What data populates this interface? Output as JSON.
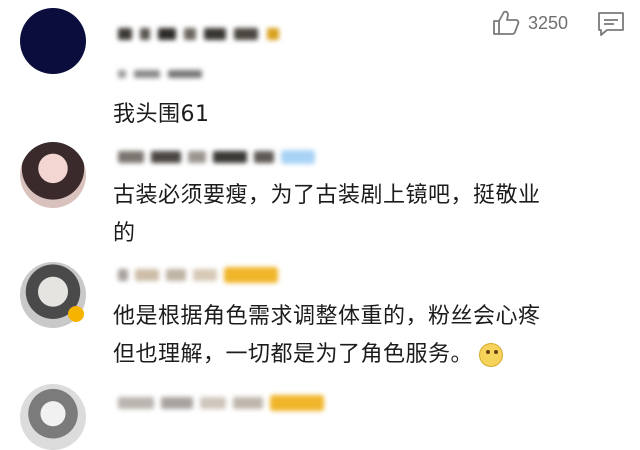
{
  "comments": [
    {
      "likes": "3250",
      "text": "我头围61"
    },
    {
      "text_line1": "古装必须要瘦，为了古装剧上镜吧，挺敬业",
      "text_line2": "的"
    },
    {
      "text_line1": "他是根据角色需求调整体重的，粉丝会心疼",
      "text_line2": "但也理解，一切都是为了角色服务。"
    }
  ],
  "icons": {
    "like": "thumbs-up-icon",
    "reply": "reply-icon",
    "verified_badge": "verified-badge-icon",
    "emoji": "emoji-icon"
  },
  "colors": {
    "avatar_dark": "#0b0e3c",
    "like_gray": "#6f6f6f",
    "gold_tag": "#f0b52a",
    "blue_tag": "#a9d3f5"
  }
}
